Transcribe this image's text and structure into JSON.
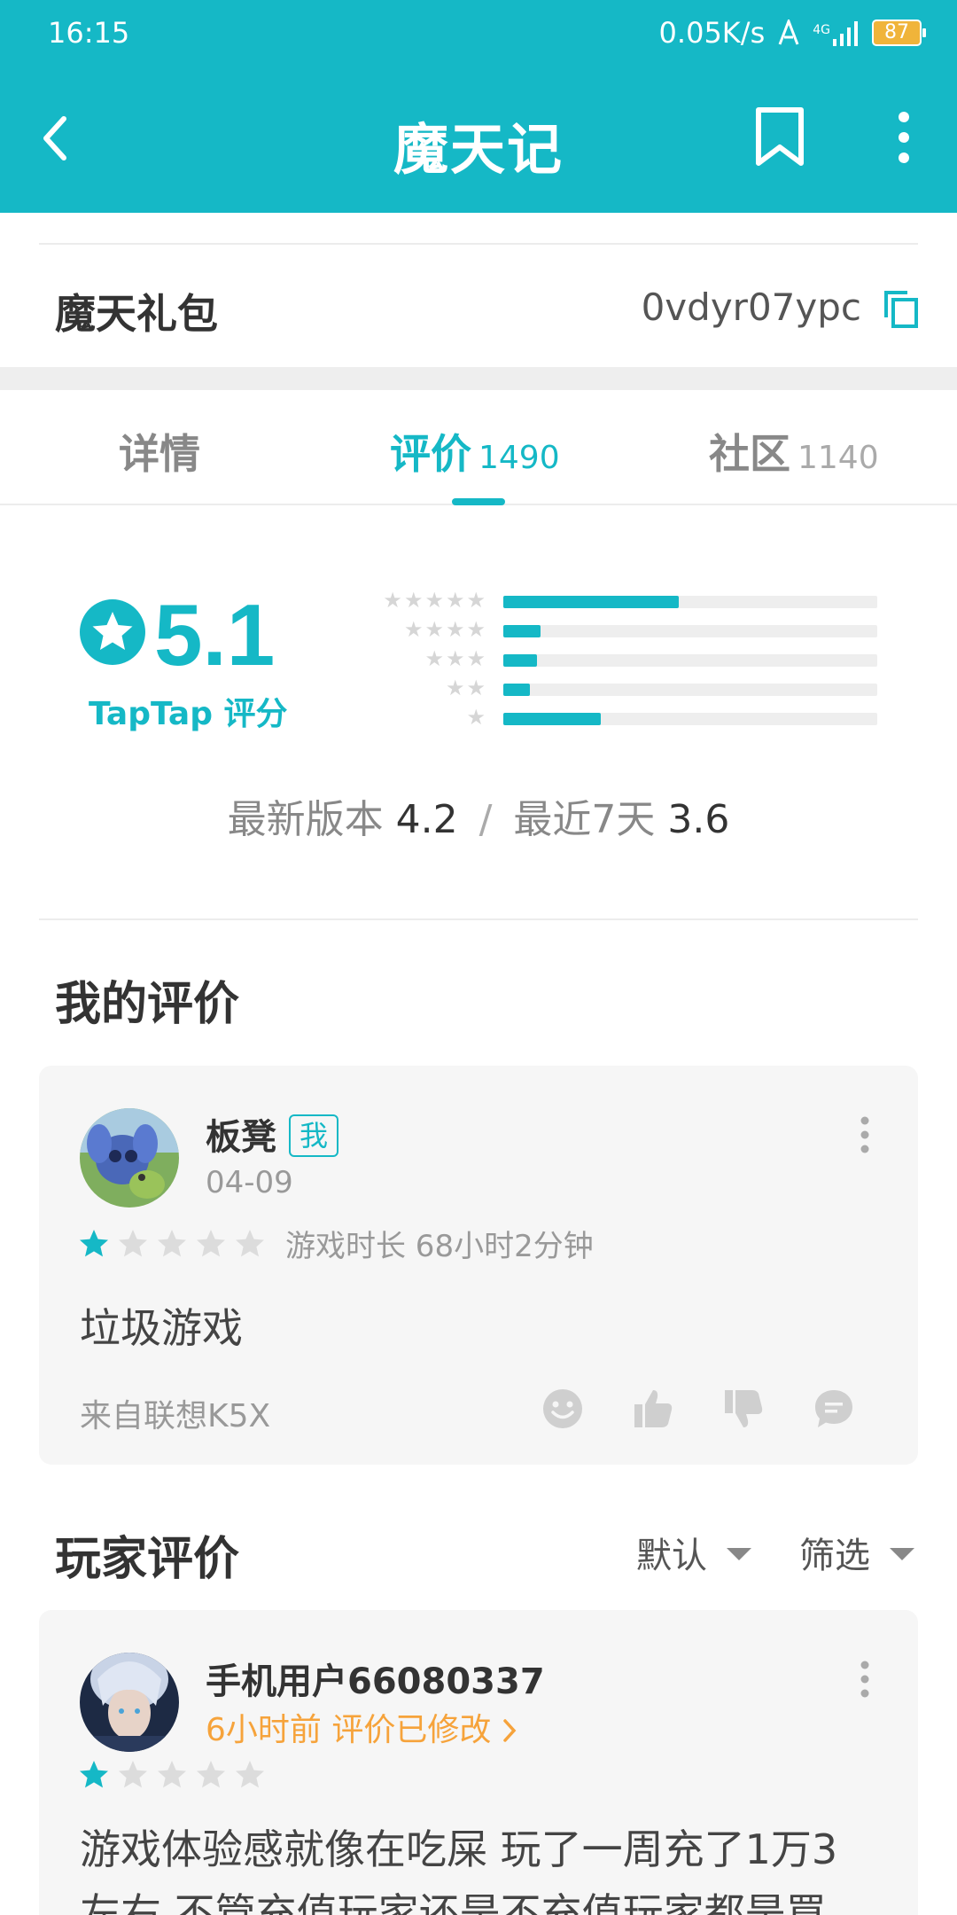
{
  "status_bar": {
    "time": "16:15",
    "speed": "0.05K/s",
    "network": "4G",
    "battery": "87"
  },
  "header": {
    "title": "魔天记"
  },
  "gift": {
    "label": "魔天礼包",
    "code": "0vdyr07ypc"
  },
  "tabs": [
    {
      "label": "详情",
      "count": ""
    },
    {
      "label": "评价",
      "count": "1490"
    },
    {
      "label": "社区",
      "count": "1140"
    }
  ],
  "active_tab": "评价",
  "rating": {
    "score": "5.1",
    "caption": "TapTap 评分",
    "distribution": [
      {
        "stars": 5,
        "fraction": 0.47
      },
      {
        "stars": 4,
        "fraction": 0.1
      },
      {
        "stars": 3,
        "fraction": 0.09
      },
      {
        "stars": 2,
        "fraction": 0.07
      },
      {
        "stars": 1,
        "fraction": 0.26
      }
    ],
    "latest_label": "最新版本",
    "latest_value": "4.2",
    "separator": "/",
    "recent_label": "最近7天",
    "recent_value": "3.6"
  },
  "my_review": {
    "section_title": "我的评价",
    "username": "板凳",
    "badge": "我",
    "date": "04-09",
    "stars": 1,
    "playtime": "游戏时长 68小时2分钟",
    "content": "垃圾游戏",
    "device": "来自联想K5X"
  },
  "player_reviews": {
    "section_title": "玩家评价",
    "sort_label": "默认",
    "filter_label": "筛选",
    "items": [
      {
        "username": "手机用户66080337",
        "time": "6小时前",
        "modified": "评价已修改",
        "stars": 1,
        "content_line1": "游戏体验感就像在吃屎 玩了一周充了1万3",
        "content_line2": "左右 不管充值玩家还是不充值玩家都是買"
      }
    ]
  },
  "colors": {
    "accent": "#15b8c6",
    "modified": "#f6a33b",
    "battery": "#f0b43a"
  }
}
